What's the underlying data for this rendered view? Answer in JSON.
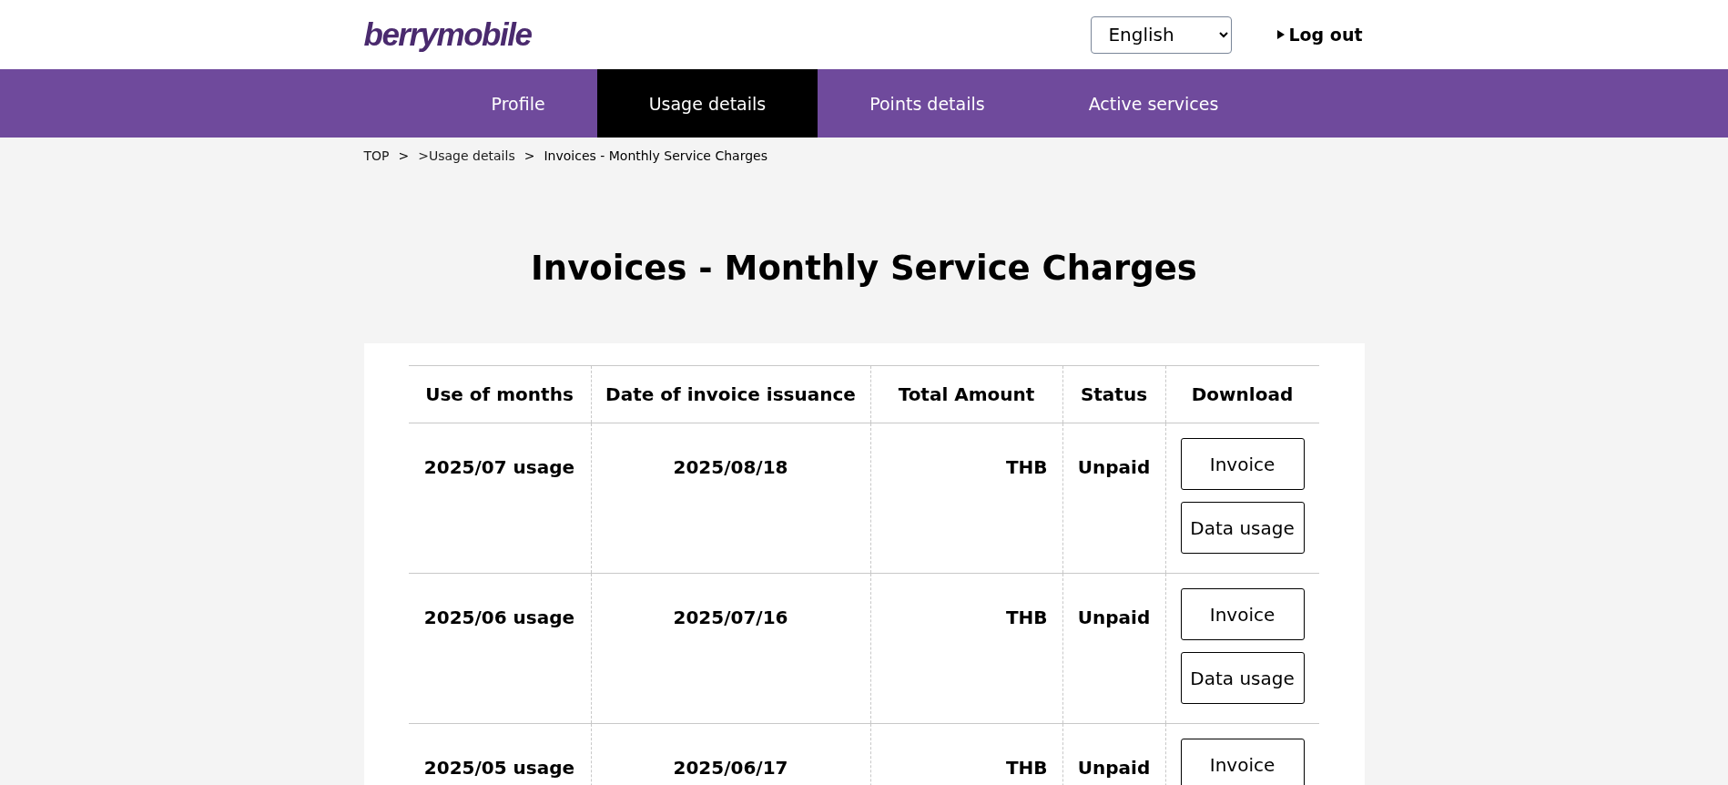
{
  "header": {
    "logo": "berrymobile",
    "language": "English",
    "logout": "Log out"
  },
  "nav": [
    {
      "label": "Profile",
      "selected": false
    },
    {
      "label": "Usage details",
      "selected": true
    },
    {
      "label": "Points details",
      "selected": false
    },
    {
      "label": "Active services",
      "selected": false
    }
  ],
  "breadcrumb": [
    {
      "kind": "link",
      "text": "TOP"
    },
    {
      "kind": "separator",
      "text": ">"
    },
    {
      "kind": "link",
      "text": ">Usage details"
    },
    {
      "kind": "separator",
      "text": ">"
    },
    {
      "kind": "current",
      "text": "Invoices - Monthly Service Charges"
    }
  ],
  "title": "Invoices - Monthly Service Charges",
  "table": {
    "columns": [
      "Use of months",
      "Date of invoice issuance",
      "Total Amount",
      "Status",
      "Download"
    ],
    "rows": [
      {
        "month": "2025/07 usage",
        "issued": "2025/08/18",
        "amount": "THB",
        "status": "Unpaid",
        "downloads": [
          "Invoice",
          "Data usage"
        ]
      },
      {
        "month": "2025/06 usage",
        "issued": "2025/07/16",
        "amount": "THB",
        "status": "Unpaid",
        "downloads": [
          "Invoice",
          "Data usage"
        ]
      },
      {
        "month": "2025/05 usage",
        "issued": "2025/06/17",
        "amount": "THB",
        "status": "Unpaid",
        "downloads": [
          "Invoice"
        ]
      }
    ]
  }
}
